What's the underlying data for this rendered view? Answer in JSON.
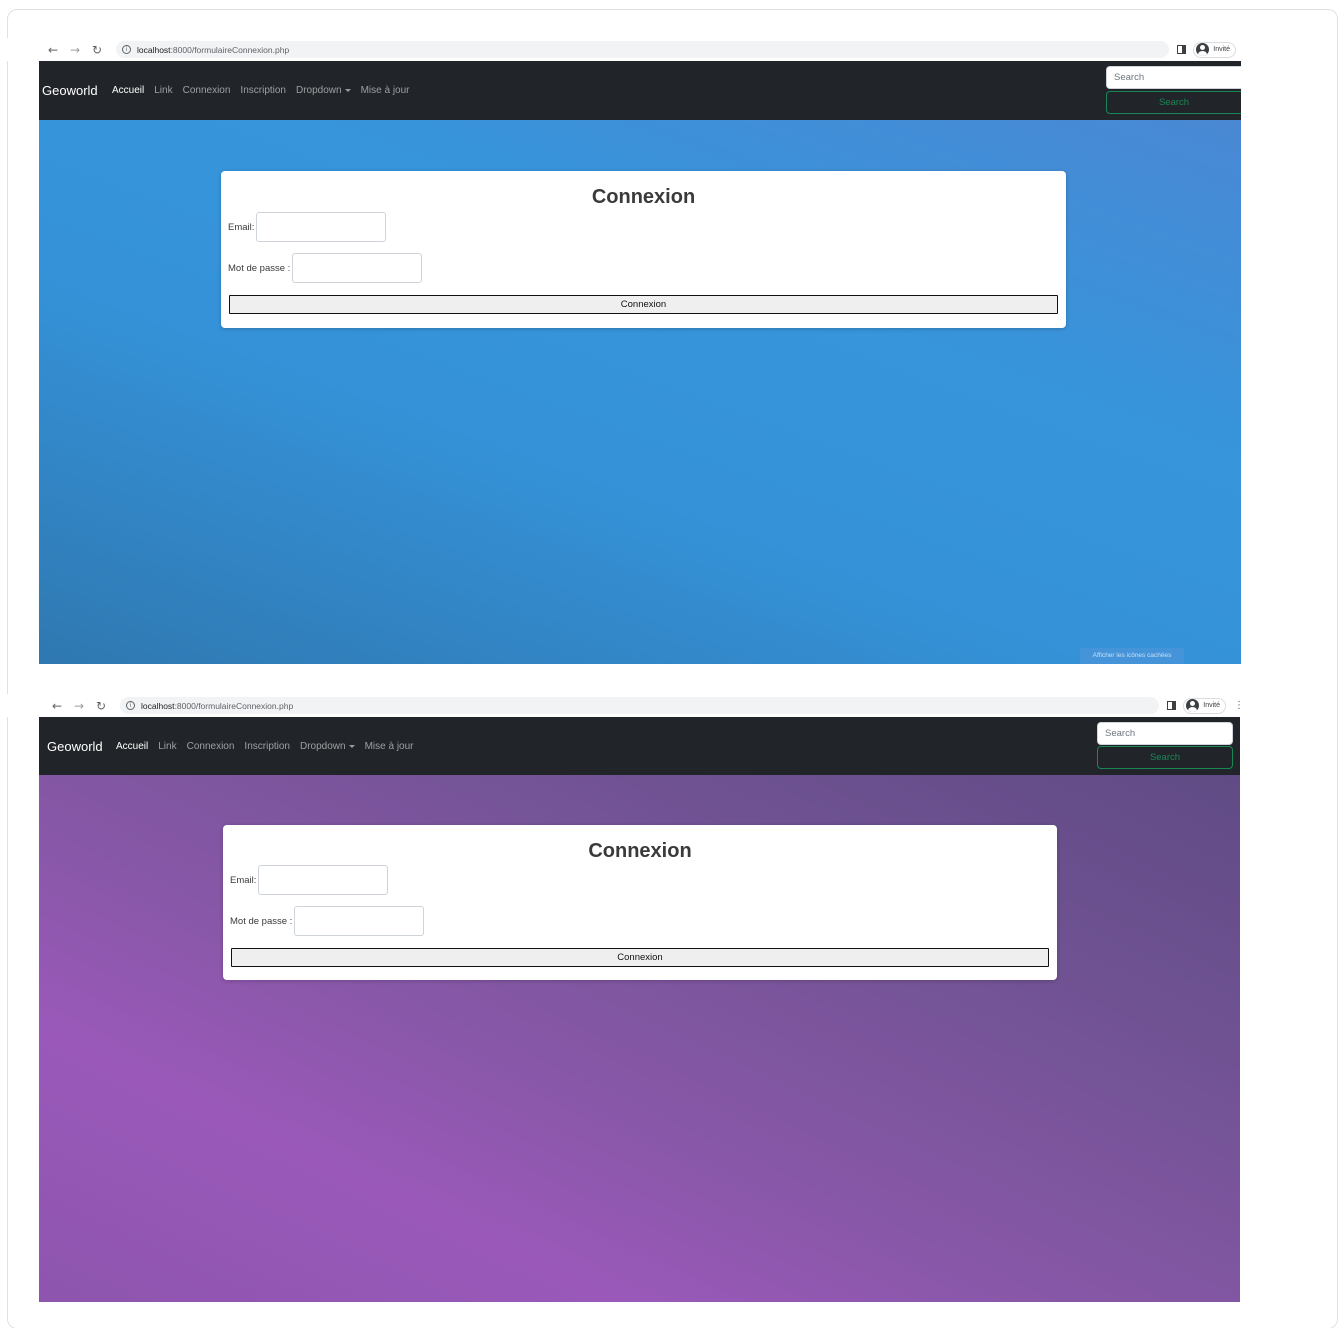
{
  "screenshots": [
    {
      "browser": {
        "url_host": "localhost",
        "url_path": ":8000/formulaireConnexion.php",
        "profile_label": "Invité"
      },
      "navbar": {
        "brand": "Geoworld",
        "links": [
          "Accueil",
          "Link",
          "Connexion",
          "Inscription",
          "Dropdown",
          "Mise à jour"
        ],
        "search_placeholder": "Search",
        "search_button": "Search"
      },
      "form": {
        "title": "Connexion",
        "email_label": "Email:",
        "password_label": "Mot de passe :",
        "submit_label": "Connexion"
      },
      "overlay_text": "Afficher les icônes cachées",
      "background": [
        "#4a88d4",
        "#3695db",
        "#2f78b1"
      ]
    },
    {
      "browser": {
        "url_host": "localhost",
        "url_path": ":8000/formulaireConnexion.php",
        "profile_label": "Invité"
      },
      "navbar": {
        "brand": "Geoworld",
        "links": [
          "Accueil",
          "Link",
          "Connexion",
          "Inscription",
          "Dropdown",
          "Mise à jour"
        ],
        "search_placeholder": "Search",
        "search_button": "Search"
      },
      "form": {
        "title": "Connexion",
        "email_label": "Email:",
        "password_label": "Mot de passe :",
        "submit_label": "Connexion"
      },
      "background": [
        "#604b85",
        "#8657a6",
        "#9a59b9"
      ]
    }
  ],
  "icons": {
    "back": "arrow-left-icon",
    "forward": "arrow-right-icon",
    "reload": "reload-icon",
    "info": "info-icon",
    "side_panel": "side-panel-icon",
    "profile": "profile-icon",
    "menu": "kebab-menu-icon"
  },
  "colors": {
    "navbar": "#212529",
    "search_button": "#198754",
    "active_link": "#ffffff",
    "inactive_link": "rgba(255,255,255,0.55)"
  }
}
